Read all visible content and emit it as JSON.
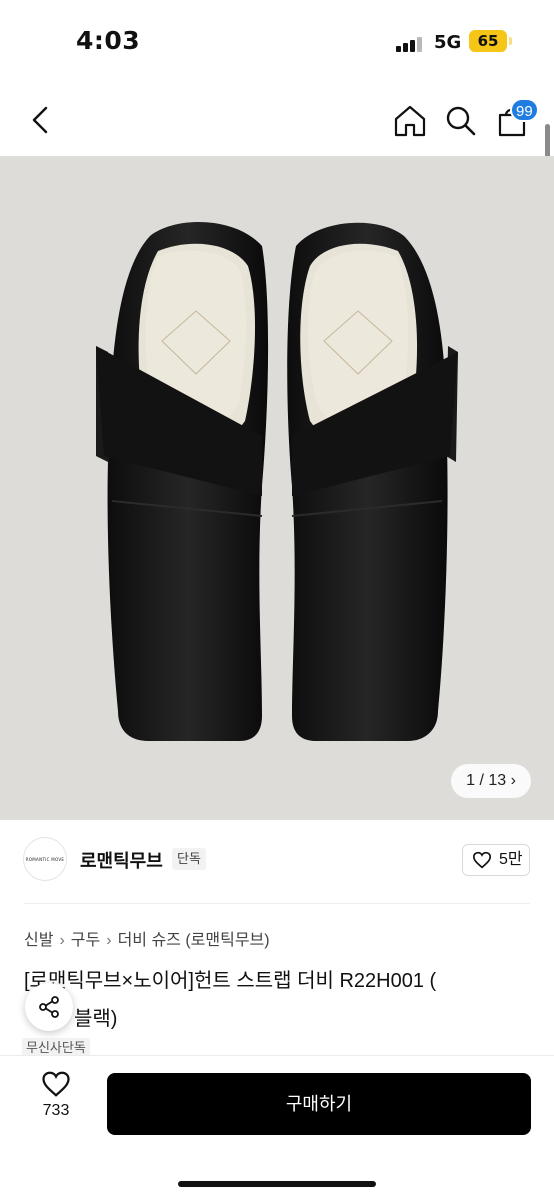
{
  "status_bar": {
    "time": "4:03",
    "network": "5G",
    "battery": "65"
  },
  "nav": {
    "back_icon": "chevron-left-icon",
    "home_icon": "home-icon",
    "search_icon": "search-icon",
    "cart_icon": "shopping-bag-icon",
    "cart_badge": "99"
  },
  "gallery": {
    "current": 1,
    "total": 13,
    "pager_label": "1 / 13",
    "pager_icon": "chevron-right-icon"
  },
  "brand": {
    "logo_text": "ROMANTIC MOVE",
    "name": "로맨틱무브",
    "tag": "단독",
    "likes": "5만"
  },
  "breadcrumb": [
    "신발",
    "구두",
    "더비 슈즈 (로맨틱무브)"
  ],
  "product": {
    "title_line1": "[로맨틱무브×노이어]헌트 스트랩 더비 R22H001 (",
    "title_line2": "블랙)",
    "exclusive_tag": "무신사단독"
  },
  "bottom_bar": {
    "wish_count": "733",
    "buy_label": "구매하기"
  },
  "colors": {
    "accent_badge": "#1f7ce0",
    "battery": "#f5c518",
    "buy_button": "#000000",
    "hero_bg": "#dddcd9"
  }
}
